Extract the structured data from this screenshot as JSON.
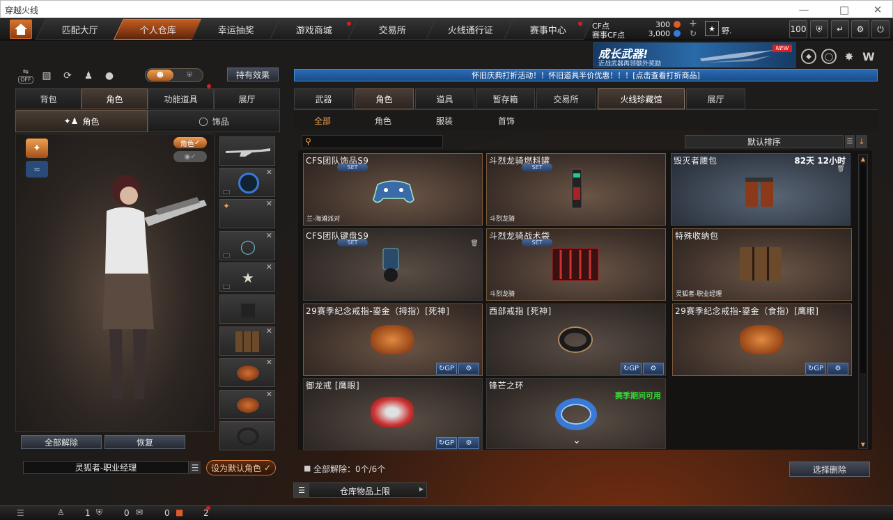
{
  "window": {
    "title": "穿越火线"
  },
  "nav": {
    "tabs": [
      "匹配大厅",
      "个人仓库",
      "幸运抽奖",
      "游戏商城",
      "交易所",
      "火线通行证",
      "赛事中心"
    ],
    "active": "个人仓库",
    "cf_label": "CF点",
    "cf_value": "300",
    "match_cf_label": "赛事CF点",
    "match_cf_value": "3,000",
    "player_name": "野.",
    "level": "100"
  },
  "promo": {
    "title": "成长武器!",
    "subtitle": "近战武器再领额外奖励",
    "badge": "NEW"
  },
  "banner": {
    "text": "怀旧庆典打折活动！！怀旧道具半价优惠！！！[点击查看打折商品]"
  },
  "left": {
    "toggle_off": "OFF",
    "effects_button": "持有效果",
    "tabs": [
      "背包",
      "角色",
      "功能道具",
      "展厅"
    ],
    "active_tab": "角色",
    "subtabs": [
      "角色",
      "饰品"
    ],
    "role_badge": "角色",
    "unequip_all": "全部解除",
    "restore": "恢复",
    "role_name": "灵狐者-职业经理",
    "set_default": "设为默认角色"
  },
  "right": {
    "tabs": [
      "武器",
      "角色",
      "道具",
      "暂存箱",
      "交易所",
      "火线珍藏馆",
      "展厅"
    ],
    "active_tab": "火线珍藏馆",
    "subtabs": [
      "全部",
      "角色",
      "服装",
      "首饰"
    ],
    "active_subtab": "全部",
    "search_placeholder": "",
    "sort_label": "默认排序",
    "unequip_status": "全部解除：0个/6个",
    "select_delete": "选择删除",
    "storage_limit": "仓库物品上限"
  },
  "items": [
    {
      "name": "CFS团队饰品S9",
      "set": "SET",
      "tag": "兰-海滩派对"
    },
    {
      "name": "斗烈龙骑燃料罐",
      "set": "SET",
      "tag": "斗烈龙骑"
    },
    {
      "name": "毁灭者腰包",
      "timer": "82天 12小时"
    },
    {
      "name": "CFS团队键盘S9",
      "set": "SET"
    },
    {
      "name": "斗烈龙骑战术袋",
      "set": "SET",
      "tag": "斗烈龙骑"
    },
    {
      "name": "特殊收纳包",
      "tag": "灵狐者-职业经理"
    },
    {
      "name": "29赛季纪念戒指-鎏金（拇指）[死神]"
    },
    {
      "name": "西部戒指 [死神]"
    },
    {
      "name": "29赛季纪念戒指-鎏金（食指）[鹰眼]"
    },
    {
      "name": "御龙戒 [鹰眼]"
    },
    {
      "name": "锋芒之环",
      "note": "赛季期间可用"
    }
  ],
  "bottom": {
    "count1": "1",
    "count2": "0",
    "count3": "0",
    "count4": "2"
  },
  "colors": {
    "accent": "#c55d22",
    "banner": "#2b6bb6",
    "season_note": "#34d634"
  }
}
